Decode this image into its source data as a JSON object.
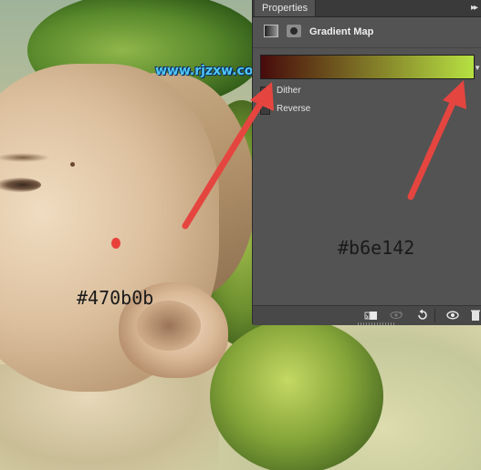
{
  "panel": {
    "tab_label": "Properties",
    "collapse_label": "▸▸",
    "title": "Gradient Map",
    "options": [
      {
        "label": "Dither",
        "checked": false
      },
      {
        "label": "Reverse",
        "checked": false
      }
    ],
    "gradient": {
      "start_color": "#470b0b",
      "end_color": "#b6e142"
    }
  },
  "watermark": "www.rjzxw.com",
  "annotations": {
    "left_color": "#470b0b",
    "right_color": "#b6e142"
  },
  "colors": {
    "arrow": "#e5453f",
    "panel_bg": "#535353"
  }
}
